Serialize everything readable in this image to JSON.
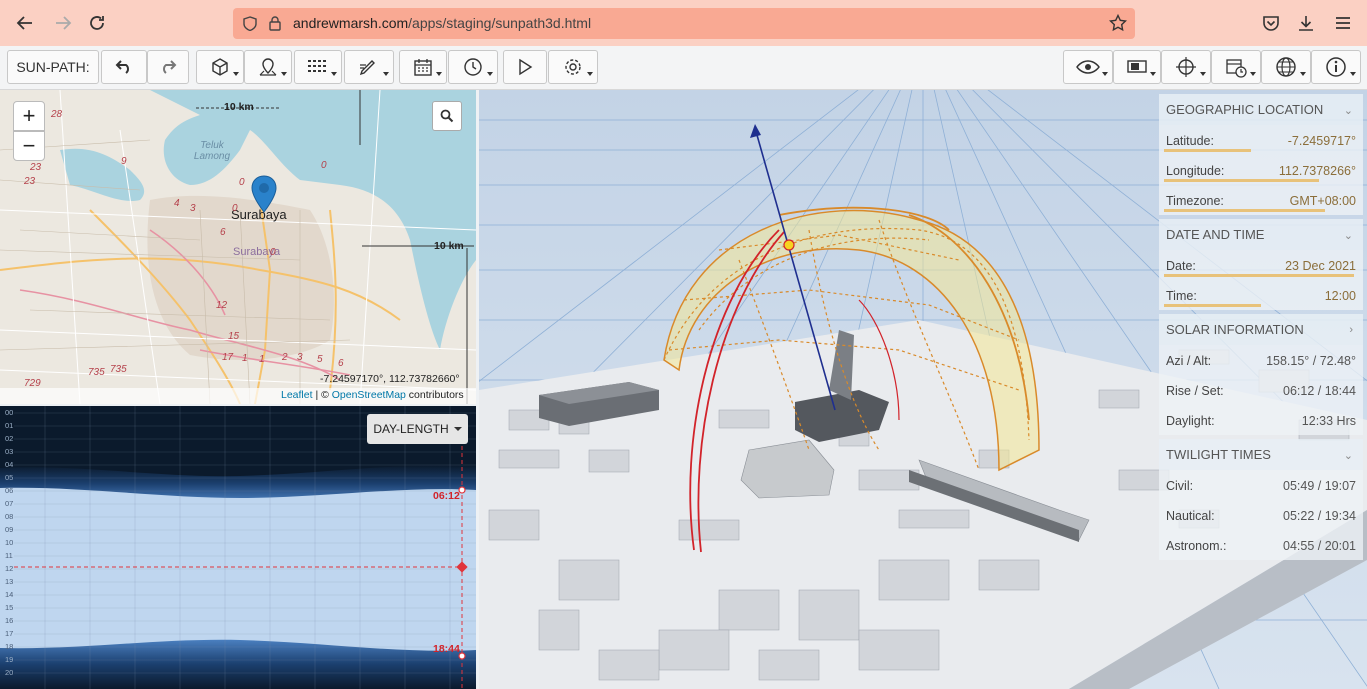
{
  "browser": {
    "url_host": "andrewmarsh.com",
    "url_path": "/apps/staging/sunpath3d.html"
  },
  "toolbar": {
    "label": "SUN-PATH:"
  },
  "map": {
    "scale_top": "10 km",
    "scale_right": "10 km",
    "city_label": "Surabaya",
    "city_label_secondary": "Surabaya",
    "place_label": "Teluk Lamong",
    "coords": "-7.24597170°, 112.73782660°",
    "attribution_leaflet": "Leaflet",
    "attribution_sep": " | © ",
    "attribution_osm": "OpenStreetMap",
    "attribution_tail": " contributors",
    "road_numbers": [
      "28",
      "23",
      "23",
      "9",
      "4",
      "3",
      "6",
      "0",
      "0",
      "0",
      "12",
      "15",
      "17",
      "1",
      "1",
      "2",
      "3",
      "5",
      "6",
      "735",
      "735",
      "729",
      "0"
    ]
  },
  "daylength": {
    "button_label": "DAY-LENGTH",
    "hours": [
      "00",
      "01",
      "02",
      "03",
      "04",
      "05",
      "06",
      "07",
      "08",
      "09",
      "10",
      "11",
      "12",
      "13",
      "14",
      "15",
      "16",
      "17",
      "18",
      "19",
      "20"
    ],
    "sunrise_label": "06:12",
    "sunset_label": "18:44"
  },
  "info": {
    "geo": {
      "title": "GEOGRAPHIC LOCATION",
      "rows": [
        {
          "label": "Latitude:",
          "value": "-7.2459717°",
          "fill": 0.45
        },
        {
          "label": "Longitude:",
          "value": "112.7378266°",
          "fill": 0.8
        },
        {
          "label": "Timezone:",
          "value": "GMT+08:00",
          "fill": 0.83
        }
      ]
    },
    "datetime": {
      "title": "DATE AND TIME",
      "rows": [
        {
          "label": "Date:",
          "value": "23 Dec 2021",
          "fill": 0.98
        },
        {
          "label": "Time:",
          "value": "12:00",
          "fill": 0.5
        }
      ]
    },
    "solar": {
      "title": "SOLAR INFORMATION",
      "rows": [
        {
          "label": "Azi / Alt:",
          "value": "158.15° / 72.48°"
        },
        {
          "label": "Rise / Set:",
          "value": "06:12 / 18:44"
        },
        {
          "label": "Daylight:",
          "value": "12:33 Hrs"
        }
      ]
    },
    "twilight": {
      "title": "TWILIGHT TIMES",
      "rows": [
        {
          "label": "Civil:",
          "value": "05:49 / 19:07"
        },
        {
          "label": "Nautical:",
          "value": "05:22 / 19:34"
        },
        {
          "label": "Astronom.:",
          "value": "04:55 / 20:01"
        }
      ]
    }
  },
  "colors": {
    "accent": "#e8c27a",
    "sun_path": "#d98a2a",
    "sun_vector": "#1f2f8f",
    "marker": "#2a82cb"
  }
}
